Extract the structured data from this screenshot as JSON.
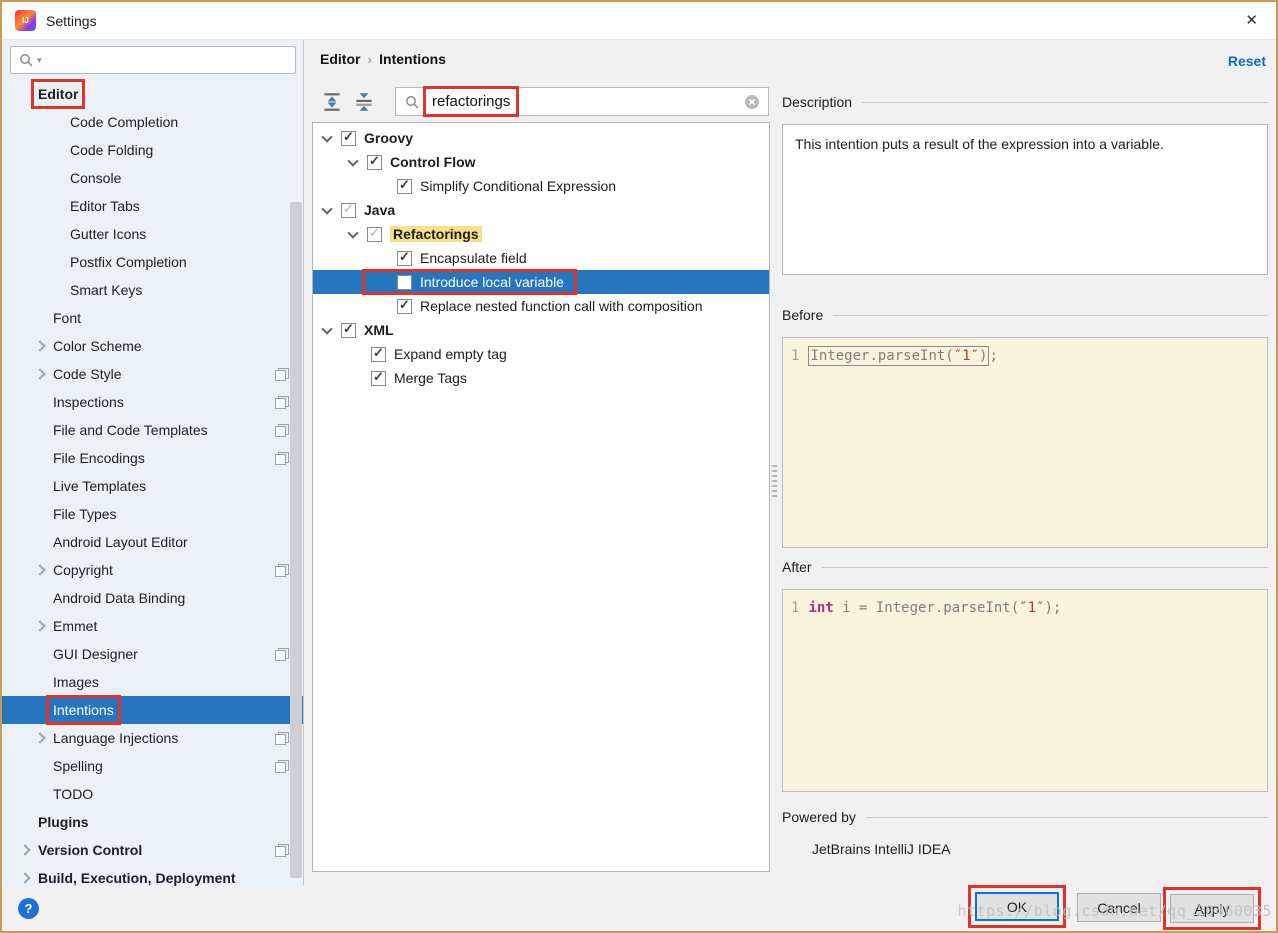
{
  "window": {
    "title": "Settings",
    "close_glyph": "✕"
  },
  "colors": {
    "selection_blue": "#2675BF",
    "annotation_red": "#DF342C",
    "highlight_yellow": "#F7E186",
    "window_border_gold": "#C99C56",
    "reset_link_blue": "#0A6CC6",
    "code_keyword_pink": "#C3287B",
    "code_string_red": "#A93A38",
    "code_background_cream": "#FAF3DE",
    "help_button_blue": "#1B74D2"
  },
  "sidebar": {
    "search_placeholder": "",
    "items": [
      {
        "label": "Editor",
        "ind": 0,
        "bold": true,
        "annot": true
      },
      {
        "label": "Code Completion",
        "ind": 2
      },
      {
        "label": "Code Folding",
        "ind": 2
      },
      {
        "label": "Console",
        "ind": 2
      },
      {
        "label": "Editor Tabs",
        "ind": 2
      },
      {
        "label": "Gutter Icons",
        "ind": 2
      },
      {
        "label": "Postfix Completion",
        "ind": 2
      },
      {
        "label": "Smart Keys",
        "ind": 2
      },
      {
        "label": "Font",
        "ind": 1
      },
      {
        "label": "Color Scheme",
        "ind": 1,
        "chev": true
      },
      {
        "label": "Code Style",
        "ind": 1,
        "chev": true,
        "pane": true
      },
      {
        "label": "Inspections",
        "ind": 1,
        "pane": true
      },
      {
        "label": "File and Code Templates",
        "ind": 1,
        "pane": true
      },
      {
        "label": "File Encodings",
        "ind": 1,
        "pane": true
      },
      {
        "label": "Live Templates",
        "ind": 1
      },
      {
        "label": "File Types",
        "ind": 1
      },
      {
        "label": "Android Layout Editor",
        "ind": 1
      },
      {
        "label": "Copyright",
        "ind": 1,
        "chev": true,
        "pane": true
      },
      {
        "label": "Android Data Binding",
        "ind": 1
      },
      {
        "label": "Emmet",
        "ind": 1,
        "chev": true
      },
      {
        "label": "GUI Designer",
        "ind": 1,
        "pane": true
      },
      {
        "label": "Images",
        "ind": 1
      },
      {
        "label": "Intentions",
        "ind": 1,
        "sel": true,
        "annot": true
      },
      {
        "label": "Language Injections",
        "ind": 1,
        "chev": true,
        "pane": true
      },
      {
        "label": "Spelling",
        "ind": 1,
        "pane": true
      },
      {
        "label": "TODO",
        "ind": 1
      },
      {
        "label": "Plugins",
        "ind": 0,
        "bold": true
      },
      {
        "label": "Version Control",
        "ind": 0,
        "bold": true,
        "chev": true,
        "pane": true
      },
      {
        "label": "Build, Execution, Deployment",
        "ind": 0,
        "bold": true,
        "chev": true
      }
    ]
  },
  "breadcrumb": {
    "parts": [
      "Editor",
      "Intentions"
    ],
    "sep": "›",
    "reset": "Reset"
  },
  "tree_search": {
    "value": "refactorings"
  },
  "tree": {
    "items": [
      {
        "label": "Groovy",
        "x": 8,
        "chev": true,
        "cb": "on",
        "bold": true
      },
      {
        "label": "Control Flow",
        "x": 34,
        "chev": true,
        "cb": "on",
        "bold": true
      },
      {
        "label": "Simplify Conditional Expression",
        "x": 84,
        "cb": "on"
      },
      {
        "label": "Java",
        "x": 8,
        "chev": true,
        "cb": "gray",
        "bold": true
      },
      {
        "label": "Refactorings",
        "x": 34,
        "chev": true,
        "cb": "gray",
        "bold": true,
        "hl": true
      },
      {
        "label": "Encapsulate field",
        "x": 84,
        "cb": "on"
      },
      {
        "label": "Introduce local variable",
        "x": 84,
        "cb": "off",
        "sel": true,
        "annot": true
      },
      {
        "label": "Replace nested function call with composition",
        "x": 84,
        "cb": "on"
      },
      {
        "label": "XML",
        "x": 8,
        "chev": true,
        "cb": "on",
        "bold": true
      },
      {
        "label": "Expand empty tag",
        "x": 58,
        "cb": "on"
      },
      {
        "label": "Merge Tags",
        "x": 58,
        "cb": "on"
      }
    ]
  },
  "description": {
    "label": "Description",
    "text": "This intention puts a result of the expression into a variable."
  },
  "before": {
    "label": "Before",
    "line_no": "1",
    "code_pre": "Integer.parseInt(",
    "code_str": "″1″",
    "code_close": ")",
    "code_tail": ";"
  },
  "after": {
    "label": "After",
    "line_no": "1",
    "keyword": "int",
    "code_mid": " i = Integer.parseInt(",
    "code_str": "″1″",
    "code_tail": ");"
  },
  "powered_by": {
    "label": "Powered by",
    "value": "JetBrains IntelliJ IDEA"
  },
  "buttons": {
    "ok": "OK",
    "cancel": "Cancel",
    "apply_mnemonic": "A",
    "apply_rest": "pply"
  },
  "help": {
    "label": "?"
  },
  "watermark": "https://blog.csdn.net/qq_20460035"
}
